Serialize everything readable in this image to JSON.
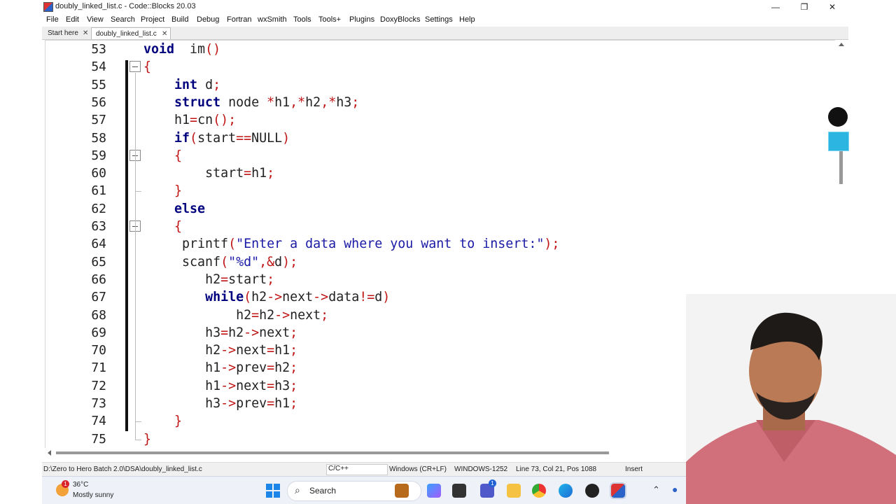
{
  "window": {
    "title": "doubly_linked_list.c - Code::Blocks 20.03",
    "minimize": "—",
    "maximize": "❐",
    "close": "✕"
  },
  "menu": [
    "File",
    "Edit",
    "View",
    "Search",
    "Project",
    "Build",
    "Debug",
    "Fortran",
    "wxSmith",
    "Tools",
    "Tools+",
    "Plugins",
    "DoxyBlocks",
    "Settings",
    "Help"
  ],
  "tabs": [
    {
      "label": "Start here",
      "close": "✕"
    },
    {
      "label": "doubly_linked_list.c",
      "close": "✕"
    }
  ],
  "editor": {
    "line_numbers": [
      "53",
      "54",
      "55",
      "56",
      "57",
      "58",
      "59",
      "60",
      "61",
      "62",
      "63",
      "64",
      "65",
      "66",
      "67",
      "68",
      "69",
      "70",
      "71",
      "72",
      "73",
      "74",
      "75"
    ],
    "code": [
      [
        [
          "kw",
          "void"
        ],
        [
          "",
          "  "
        ],
        [
          "",
          "im"
        ],
        [
          "op",
          "()"
        ]
      ],
      [
        [
          "op",
          "{"
        ]
      ],
      [
        [
          "",
          "    "
        ],
        [
          "kw",
          "int"
        ],
        [
          "",
          " d"
        ],
        [
          "op",
          ";"
        ]
      ],
      [
        [
          "",
          "    "
        ],
        [
          "kw",
          "struct"
        ],
        [
          "",
          " node "
        ],
        [
          "op",
          "*"
        ],
        [
          "",
          "h1"
        ],
        [
          "op",
          ",*"
        ],
        [
          "",
          "h2"
        ],
        [
          "op",
          ",*"
        ],
        [
          "",
          "h3"
        ],
        [
          "op",
          ";"
        ]
      ],
      [
        [
          "",
          "    "
        ],
        [
          "",
          "h1"
        ],
        [
          "op",
          "="
        ],
        [
          "",
          "cn"
        ],
        [
          "op",
          "();"
        ]
      ],
      [
        [
          "",
          "    "
        ],
        [
          "kw",
          "if"
        ],
        [
          "op",
          "("
        ],
        [
          "",
          "start"
        ],
        [
          "op",
          "=="
        ],
        [
          "",
          "NULL"
        ],
        [
          "op",
          ")"
        ]
      ],
      [
        [
          "",
          "    "
        ],
        [
          "op",
          "{"
        ]
      ],
      [
        [
          "",
          "        "
        ],
        [
          "",
          "start"
        ],
        [
          "op",
          "="
        ],
        [
          "",
          "h1"
        ],
        [
          "op",
          ";"
        ]
      ],
      [
        [
          "",
          "    "
        ],
        [
          "op",
          "}"
        ]
      ],
      [
        [
          "",
          "    "
        ],
        [
          "kw",
          "else"
        ]
      ],
      [
        [
          "",
          "    "
        ],
        [
          "op",
          "{"
        ]
      ],
      [
        [
          "",
          "     "
        ],
        [
          "",
          "printf"
        ],
        [
          "op",
          "("
        ],
        [
          "str",
          "\"Enter a data where you want to insert:\""
        ],
        [
          "op",
          ");"
        ]
      ],
      [
        [
          "",
          "     "
        ],
        [
          "",
          "scanf"
        ],
        [
          "op",
          "("
        ],
        [
          "str",
          "\"%d\""
        ],
        [
          "op",
          ",&"
        ],
        [
          "",
          "d"
        ],
        [
          "op",
          ");"
        ]
      ],
      [
        [
          "",
          "        "
        ],
        [
          "",
          "h2"
        ],
        [
          "op",
          "="
        ],
        [
          "",
          "start"
        ],
        [
          "op",
          ";"
        ]
      ],
      [
        [
          "",
          "        "
        ],
        [
          "kw",
          "while"
        ],
        [
          "op",
          "("
        ],
        [
          "",
          "h2"
        ],
        [
          "op",
          "->"
        ],
        [
          "",
          "next"
        ],
        [
          "op",
          "->"
        ],
        [
          "",
          "data"
        ],
        [
          "op",
          "!="
        ],
        [
          "",
          "d"
        ],
        [
          "op",
          ")"
        ]
      ],
      [
        [
          "",
          "            "
        ],
        [
          "",
          "h2"
        ],
        [
          "op",
          "="
        ],
        [
          "",
          "h2"
        ],
        [
          "op",
          "->"
        ],
        [
          "",
          "next"
        ],
        [
          "op",
          ";"
        ]
      ],
      [
        [
          "",
          "        "
        ],
        [
          "",
          "h3"
        ],
        [
          "op",
          "="
        ],
        [
          "",
          "h2"
        ],
        [
          "op",
          "->"
        ],
        [
          "",
          "next"
        ],
        [
          "op",
          ";"
        ]
      ],
      [
        [
          "",
          "        "
        ],
        [
          "",
          "h2"
        ],
        [
          "op",
          "->"
        ],
        [
          "",
          "next"
        ],
        [
          "op",
          "="
        ],
        [
          "",
          "h1"
        ],
        [
          "op",
          ";"
        ]
      ],
      [
        [
          "",
          "        "
        ],
        [
          "",
          "h1"
        ],
        [
          "op",
          "->"
        ],
        [
          "",
          "prev"
        ],
        [
          "op",
          "="
        ],
        [
          "",
          "h2"
        ],
        [
          "op",
          ";"
        ]
      ],
      [
        [
          "",
          "        "
        ],
        [
          "",
          "h1"
        ],
        [
          "op",
          "->"
        ],
        [
          "",
          "next"
        ],
        [
          "op",
          "="
        ],
        [
          "",
          "h3"
        ],
        [
          "op",
          ";"
        ]
      ],
      [
        [
          "",
          "        "
        ],
        [
          "",
          "h3"
        ],
        [
          "op",
          "->"
        ],
        [
          "",
          "prev"
        ],
        [
          "op",
          "="
        ],
        [
          "",
          "h1"
        ],
        [
          "op",
          ";"
        ]
      ],
      [
        [
          "",
          "    "
        ],
        [
          "op",
          "}"
        ]
      ],
      [
        [
          "op",
          "}"
        ]
      ]
    ]
  },
  "status": {
    "path": "D:\\Zero to Hero Batch 2.0\\DSA\\doubly_linked_list.c",
    "language": "C/C++",
    "eol": "Windows (CR+LF)",
    "encoding": "WINDOWS-1252",
    "position": "Line 73, Col 21, Pos 1088",
    "mode": "Insert"
  },
  "taskbar": {
    "weather_temp": "36°C",
    "weather_desc": "Mostly sunny",
    "weather_badge": "1",
    "search_label": "Search",
    "teams_badge": "1"
  },
  "colors": {
    "keyword": "#00007f",
    "operator": "#c01515",
    "string": "#1a1aa6"
  }
}
